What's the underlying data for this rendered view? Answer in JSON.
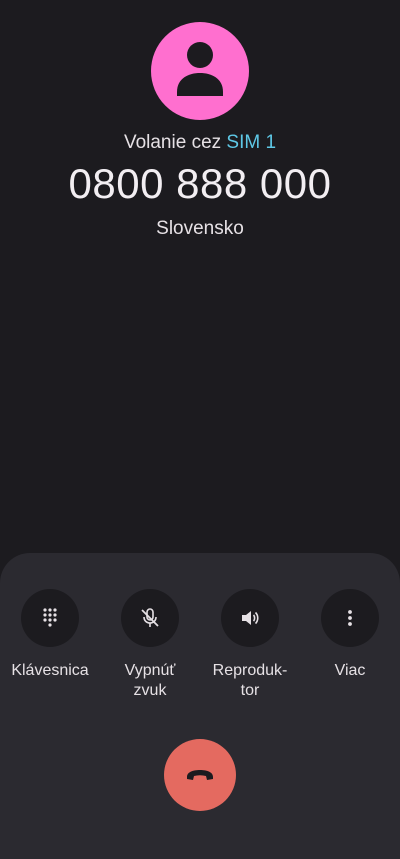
{
  "call": {
    "sim_prefix": "Volanie cez ",
    "sim_name": "SIM 1",
    "number": "0800 888 000",
    "country": "Slovensko"
  },
  "avatar": {
    "icon": "person-icon",
    "color": "#ff6fcf"
  },
  "controls": [
    {
      "icon": "dialpad-icon",
      "label": "Klávesnica"
    },
    {
      "icon": "mic-off-icon",
      "label": "Vypnúť\nzvuk"
    },
    {
      "icon": "speaker-icon",
      "label": "Reproduk-\ntor"
    },
    {
      "icon": "more-vert-icon",
      "label": "Viac"
    }
  ],
  "end_call": {
    "icon": "call-end-icon",
    "color": "#e46a60"
  },
  "colors": {
    "background": "#1c1b1f",
    "panel": "#2b2a30",
    "accent": "#5ec8e6"
  }
}
